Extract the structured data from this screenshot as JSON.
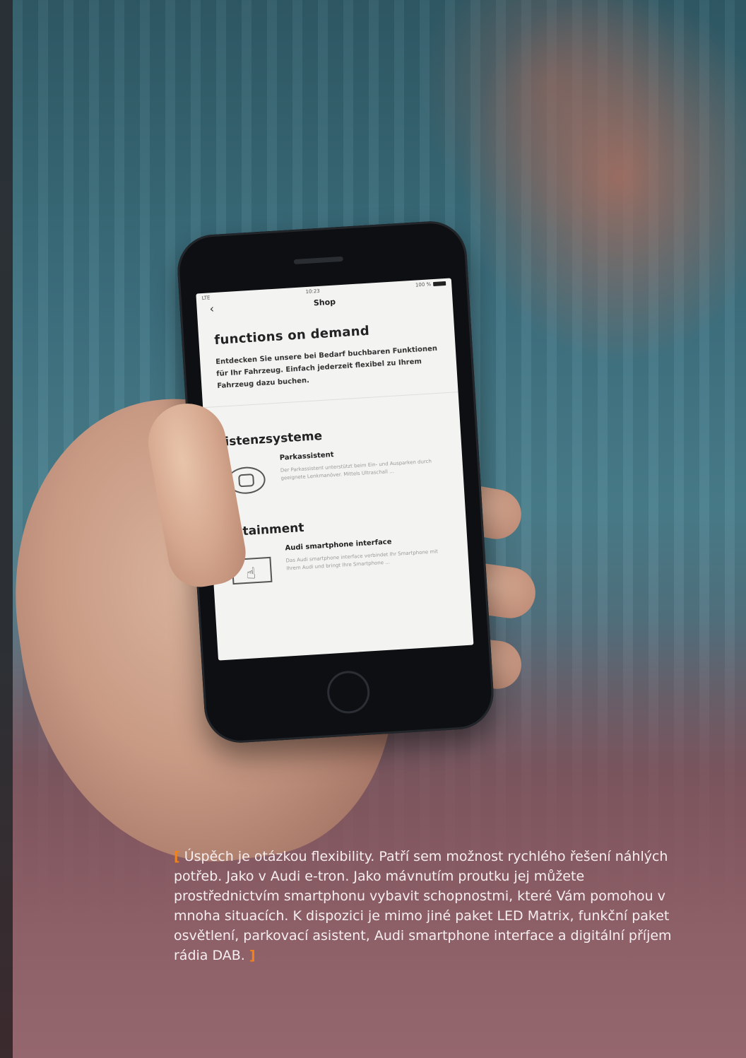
{
  "phone_screen": {
    "status": {
      "carrier": "LTE",
      "time": "10:23",
      "battery": "100 %"
    },
    "nav": {
      "back_icon": "chevron-left-icon",
      "title": "Shop"
    },
    "headline": "functions on demand",
    "intro": "Entdecken Sie unsere bei Bedarf buchbaren Funktionen für Ihr Fahrzeug. Einfach jederzeit flexibel zu Ihrem Fahrzeug dazu buchen.",
    "sections": [
      {
        "title": "ssistenzsysteme",
        "feature": {
          "icon": "car-sensor-icon",
          "name": "Parkassistent",
          "description": "Der Parkassistent unterstützt beim Ein- und Ausparken durch geeignete Lenkmanöver. Mittels Ultraschall ..."
        }
      },
      {
        "title": "Infotainment",
        "feature": {
          "icon": "touch-screen-icon",
          "name": "Audi smartphone interface",
          "description": "Das Audi smartphone interface verbindet Ihr Smartphone mit Ihrem Audi und bringt Ihre Smartphone ..."
        }
      }
    ]
  },
  "caption": {
    "open_bracket": "[",
    "text": "Úspěch je otázkou flexibility. Patří sem možnost rychlého řešení náhlých potřeb. Jako v Audi e-tron. Jako mávnutím proutku jej můžete prostřednictvím smartphonu vybavit schopnostmi, které Vám pomohou v mnoha situacích. K dispozici je mimo jiné paket LED Matrix, funkční paket osvětlení, parkovací asistent, Audi smartphone interface a digitální příjem rádia DAB.",
    "close_bracket": "]"
  },
  "colors": {
    "accent": "#f0821e",
    "caption_text": "#f6eef0"
  }
}
